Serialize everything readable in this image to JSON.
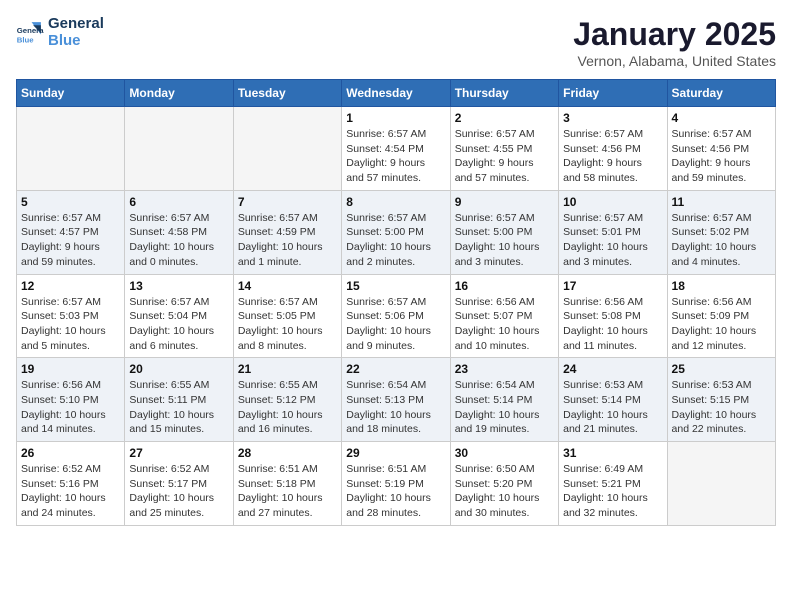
{
  "header": {
    "logo_line1": "General",
    "logo_line2": "Blue",
    "month": "January 2025",
    "location": "Vernon, Alabama, United States"
  },
  "weekdays": [
    "Sunday",
    "Monday",
    "Tuesday",
    "Wednesday",
    "Thursday",
    "Friday",
    "Saturday"
  ],
  "weeks": [
    [
      {
        "day": "",
        "info": ""
      },
      {
        "day": "",
        "info": ""
      },
      {
        "day": "",
        "info": ""
      },
      {
        "day": "1",
        "info": "Sunrise: 6:57 AM\nSunset: 4:54 PM\nDaylight: 9 hours\nand 57 minutes."
      },
      {
        "day": "2",
        "info": "Sunrise: 6:57 AM\nSunset: 4:55 PM\nDaylight: 9 hours\nand 57 minutes."
      },
      {
        "day": "3",
        "info": "Sunrise: 6:57 AM\nSunset: 4:56 PM\nDaylight: 9 hours\nand 58 minutes."
      },
      {
        "day": "4",
        "info": "Sunrise: 6:57 AM\nSunset: 4:56 PM\nDaylight: 9 hours\nand 59 minutes."
      }
    ],
    [
      {
        "day": "5",
        "info": "Sunrise: 6:57 AM\nSunset: 4:57 PM\nDaylight: 9 hours\nand 59 minutes."
      },
      {
        "day": "6",
        "info": "Sunrise: 6:57 AM\nSunset: 4:58 PM\nDaylight: 10 hours\nand 0 minutes."
      },
      {
        "day": "7",
        "info": "Sunrise: 6:57 AM\nSunset: 4:59 PM\nDaylight: 10 hours\nand 1 minute."
      },
      {
        "day": "8",
        "info": "Sunrise: 6:57 AM\nSunset: 5:00 PM\nDaylight: 10 hours\nand 2 minutes."
      },
      {
        "day": "9",
        "info": "Sunrise: 6:57 AM\nSunset: 5:00 PM\nDaylight: 10 hours\nand 3 minutes."
      },
      {
        "day": "10",
        "info": "Sunrise: 6:57 AM\nSunset: 5:01 PM\nDaylight: 10 hours\nand 3 minutes."
      },
      {
        "day": "11",
        "info": "Sunrise: 6:57 AM\nSunset: 5:02 PM\nDaylight: 10 hours\nand 4 minutes."
      }
    ],
    [
      {
        "day": "12",
        "info": "Sunrise: 6:57 AM\nSunset: 5:03 PM\nDaylight: 10 hours\nand 5 minutes."
      },
      {
        "day": "13",
        "info": "Sunrise: 6:57 AM\nSunset: 5:04 PM\nDaylight: 10 hours\nand 6 minutes."
      },
      {
        "day": "14",
        "info": "Sunrise: 6:57 AM\nSunset: 5:05 PM\nDaylight: 10 hours\nand 8 minutes."
      },
      {
        "day": "15",
        "info": "Sunrise: 6:57 AM\nSunset: 5:06 PM\nDaylight: 10 hours\nand 9 minutes."
      },
      {
        "day": "16",
        "info": "Sunrise: 6:56 AM\nSunset: 5:07 PM\nDaylight: 10 hours\nand 10 minutes."
      },
      {
        "day": "17",
        "info": "Sunrise: 6:56 AM\nSunset: 5:08 PM\nDaylight: 10 hours\nand 11 minutes."
      },
      {
        "day": "18",
        "info": "Sunrise: 6:56 AM\nSunset: 5:09 PM\nDaylight: 10 hours\nand 12 minutes."
      }
    ],
    [
      {
        "day": "19",
        "info": "Sunrise: 6:56 AM\nSunset: 5:10 PM\nDaylight: 10 hours\nand 14 minutes."
      },
      {
        "day": "20",
        "info": "Sunrise: 6:55 AM\nSunset: 5:11 PM\nDaylight: 10 hours\nand 15 minutes."
      },
      {
        "day": "21",
        "info": "Sunrise: 6:55 AM\nSunset: 5:12 PM\nDaylight: 10 hours\nand 16 minutes."
      },
      {
        "day": "22",
        "info": "Sunrise: 6:54 AM\nSunset: 5:13 PM\nDaylight: 10 hours\nand 18 minutes."
      },
      {
        "day": "23",
        "info": "Sunrise: 6:54 AM\nSunset: 5:14 PM\nDaylight: 10 hours\nand 19 minutes."
      },
      {
        "day": "24",
        "info": "Sunrise: 6:53 AM\nSunset: 5:14 PM\nDaylight: 10 hours\nand 21 minutes."
      },
      {
        "day": "25",
        "info": "Sunrise: 6:53 AM\nSunset: 5:15 PM\nDaylight: 10 hours\nand 22 minutes."
      }
    ],
    [
      {
        "day": "26",
        "info": "Sunrise: 6:52 AM\nSunset: 5:16 PM\nDaylight: 10 hours\nand 24 minutes."
      },
      {
        "day": "27",
        "info": "Sunrise: 6:52 AM\nSunset: 5:17 PM\nDaylight: 10 hours\nand 25 minutes."
      },
      {
        "day": "28",
        "info": "Sunrise: 6:51 AM\nSunset: 5:18 PM\nDaylight: 10 hours\nand 27 minutes."
      },
      {
        "day": "29",
        "info": "Sunrise: 6:51 AM\nSunset: 5:19 PM\nDaylight: 10 hours\nand 28 minutes."
      },
      {
        "day": "30",
        "info": "Sunrise: 6:50 AM\nSunset: 5:20 PM\nDaylight: 10 hours\nand 30 minutes."
      },
      {
        "day": "31",
        "info": "Sunrise: 6:49 AM\nSunset: 5:21 PM\nDaylight: 10 hours\nand 32 minutes."
      },
      {
        "day": "",
        "info": ""
      }
    ]
  ]
}
